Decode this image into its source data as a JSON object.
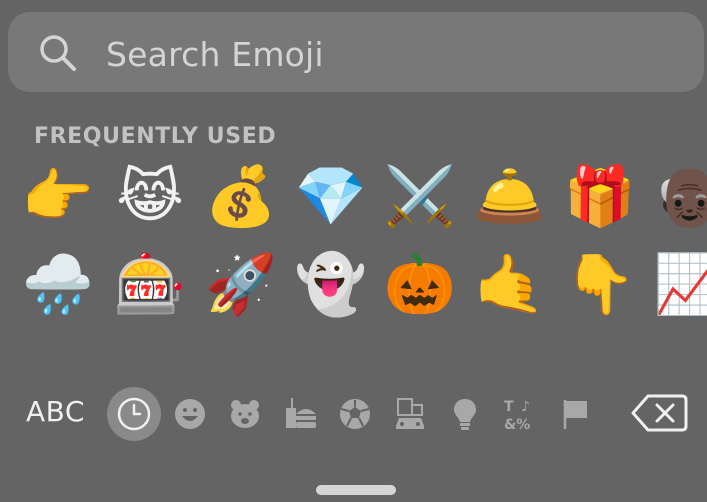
{
  "search": {
    "placeholder": "Search Emoji"
  },
  "section": {
    "title": "FREQUENTLY USED"
  },
  "emojis": {
    "row1": [
      "👉",
      "😹",
      "💰",
      "💎",
      "⚔️",
      "🛎️",
      "🎁",
      "👴🏿"
    ],
    "row2": [
      "🌧️",
      "🎰",
      "🚀",
      "👻",
      "🎃",
      "🤙",
      "👇",
      "📈"
    ]
  },
  "category_bar": {
    "abc_label": "ABC",
    "categories": [
      "clock-icon",
      "smiley-icon",
      "bear-icon",
      "food-icon",
      "ball-icon",
      "building-car-icon",
      "lightbulb-icon",
      "symbols-icon",
      "flag-icon"
    ],
    "active": "clock-icon"
  },
  "colors": {
    "background": "#646464",
    "search_bg": "#787878",
    "section_text": "#c2c2c2",
    "icon_gray": "#a8a8a8"
  }
}
